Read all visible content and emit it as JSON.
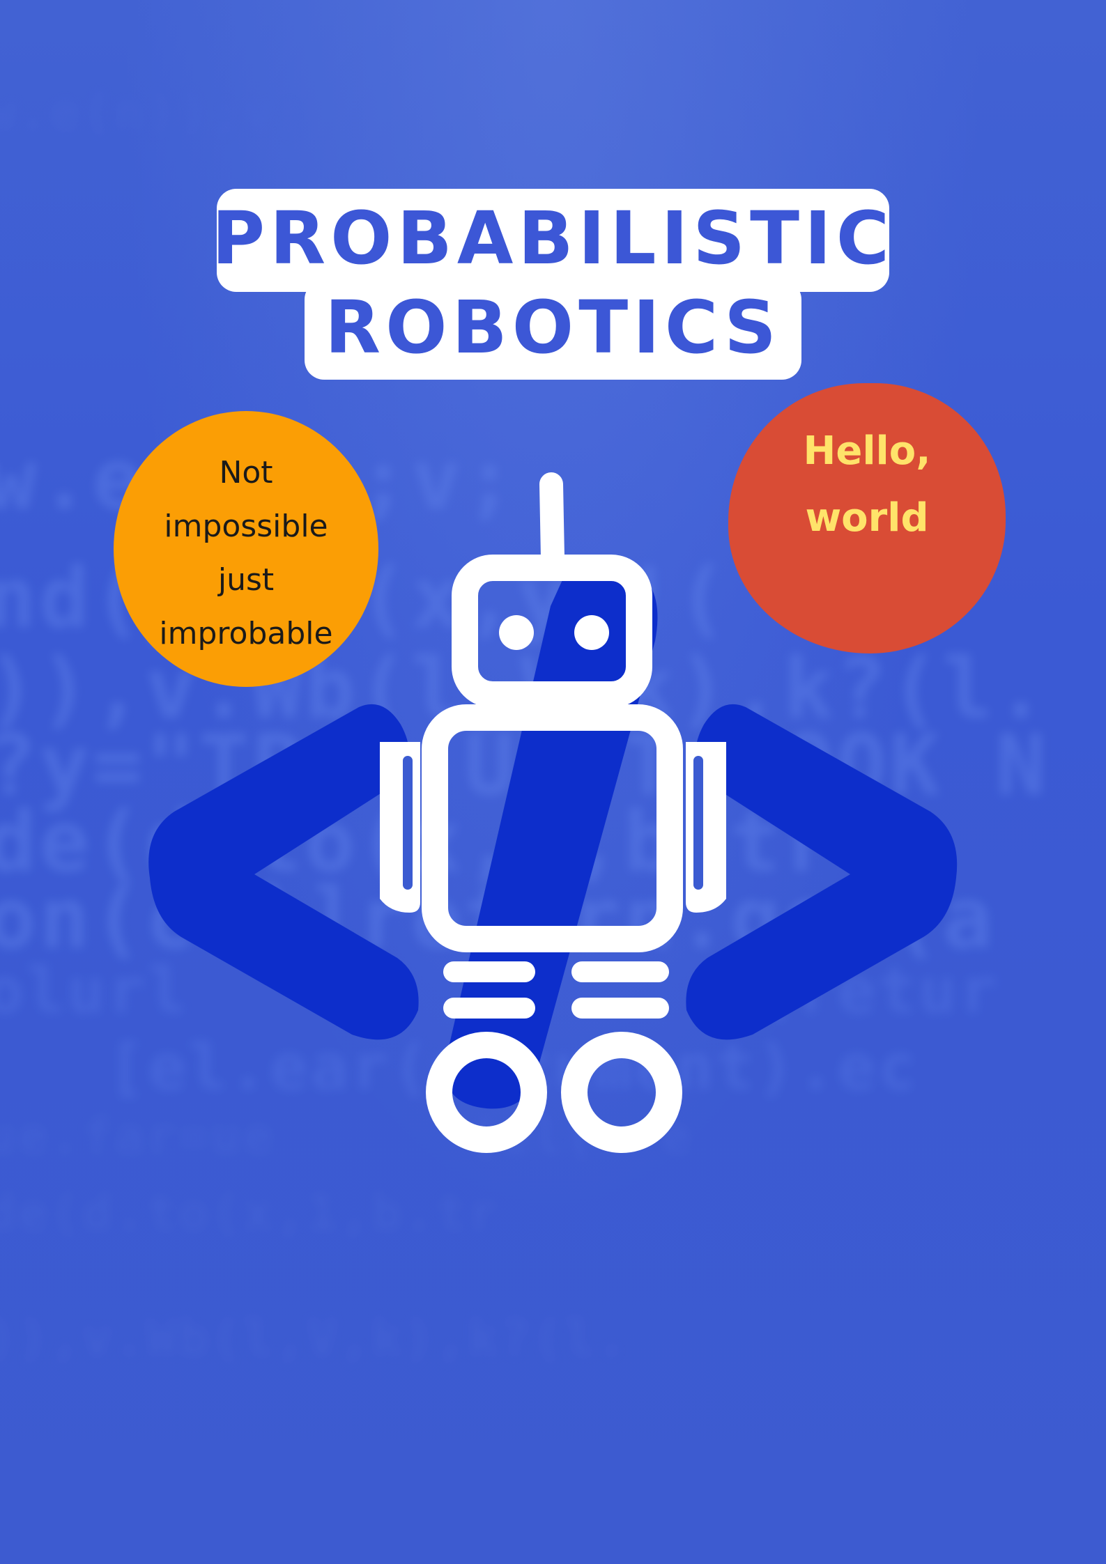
{
  "poster": {
    "title_line1": "PROBABILISTIC",
    "title_line2": "ROBOTICS",
    "bubble_left": {
      "text": "Not\nimpossible\njust\nimprobable",
      "color": "#fb9e05"
    },
    "bubble_right": {
      "text": "Hello,\nworld",
      "color": "#d94c35",
      "text_color": "#ffe36a"
    },
    "illustration": "robot-with-code-brackets-icon"
  },
  "background_code": [
    "w.e(n));v;",
    "nd(jb.c(x,y(!(",
    ")),v.Wb(l,V,k),k?(l.",
    "?y=\"TP   UEPT NOOK N",
    "de(d.to(x,1,b.tr",
    "on(ca)]return.get(a",
    "olurl              (retur",
    "   [el.ear(document).ec",
    "ue.far=ue      (el(  e"
  ],
  "colors": {
    "background": "#3b5bd1",
    "title_text": "#3c57d6",
    "brackets": "#0d2ecb",
    "robot_outline": "#ffffff"
  }
}
